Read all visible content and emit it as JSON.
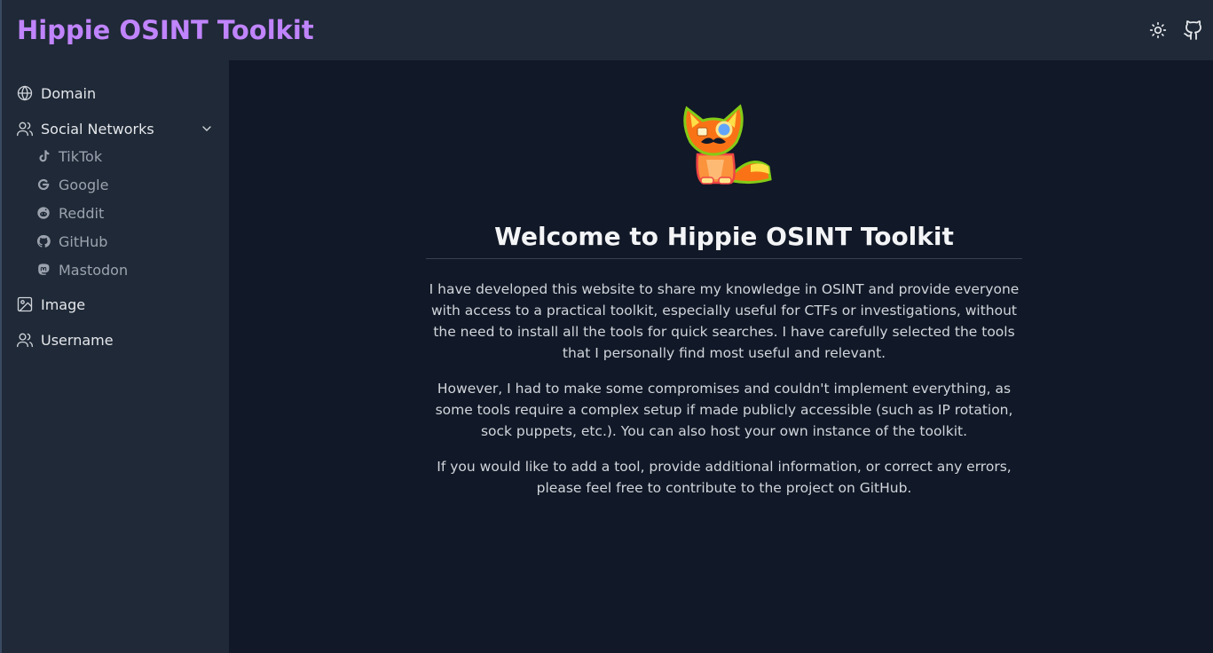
{
  "header": {
    "title": "Hippie OSINT Toolkit",
    "theme_toggle_icon": "sun-icon",
    "github_icon": "github-icon"
  },
  "sidebar": {
    "items": [
      {
        "label": "Domain",
        "icon": "globe-icon"
      },
      {
        "label": "Social Networks",
        "icon": "users-icon",
        "expanded": true,
        "children": [
          {
            "label": "TikTok",
            "icon": "tiktok-icon"
          },
          {
            "label": "Google",
            "icon": "google-icon"
          },
          {
            "label": "Reddit",
            "icon": "reddit-icon"
          },
          {
            "label": "GitHub",
            "icon": "github-icon"
          },
          {
            "label": "Mastodon",
            "icon": "mastodon-icon"
          }
        ]
      },
      {
        "label": "Image",
        "icon": "image-icon"
      },
      {
        "label": "Username",
        "icon": "users-icon"
      }
    ]
  },
  "main": {
    "heading": "Welcome to Hippie OSINT Toolkit",
    "paragraphs": [
      "I have developed this website to share my knowledge in OSINT and provide everyone with access to a practical toolkit, especially useful for CTFs or investigations, without the need to install all the tools for quick searches. I have carefully selected the tools that I personally find most useful and relevant.",
      "However, I had to make some compromises and couldn't implement everything, as some tools require a complex setup if made publicly accessible (such as IP rotation, sock puppets, etc.). You can also host your own instance of the toolkit.",
      "If you would like to add a tool, provide additional information, or correct any errors, please feel free to contribute to the project on GitHub."
    ]
  },
  "colors": {
    "brand": "#c084fc",
    "header_bg": "#1f2937",
    "sidebar_bg": "#1f2937",
    "main_bg": "#111827"
  }
}
